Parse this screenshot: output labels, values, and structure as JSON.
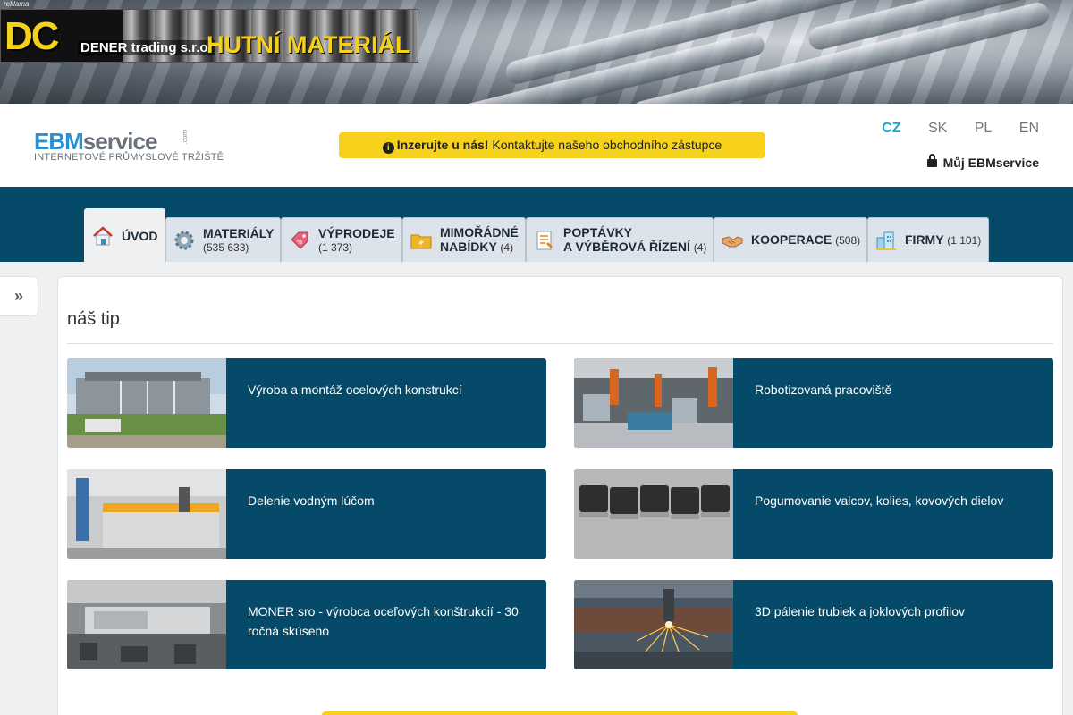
{
  "ad": {
    "label": "reklama",
    "logo": "DC",
    "company": "DENER trading s.r.o.",
    "headline": "HUTNÍ MATERIÁL"
  },
  "header": {
    "logo_ebm": "EBM",
    "logo_service": "service",
    "logo_com": ".com",
    "tagline": "INTERNETOVÉ PRŮMYSLOVÉ TRŽIŠTĚ",
    "notice_bold": "Inzerujte u nás!",
    "notice_text": " Kontaktujte našeho obchodního zástupce",
    "languages": [
      "CZ",
      "SK",
      "PL",
      "EN"
    ],
    "active_language": "CZ",
    "my_account": "Můj EBMservice"
  },
  "nav": {
    "tabs": [
      {
        "label": "ÚVOD",
        "count": "",
        "icon": "home-icon"
      },
      {
        "label": "MATERIÁLY",
        "count": "(535 633)",
        "icon": "gear-icon"
      },
      {
        "label": "VÝPRODEJE",
        "count": "(1 373)",
        "icon": "tag-icon"
      },
      {
        "label": "MIMOŘÁDNÉ",
        "label2": "NABÍDKY",
        "count": "(4)",
        "icon": "folder-icon"
      },
      {
        "label": "POPTÁVKY",
        "label2": "A VÝBĚROVÁ ŘÍZENÍ",
        "count": "(4)",
        "icon": "document-icon"
      },
      {
        "label": "KOOPERACE",
        "count": "(508)",
        "icon": "handshake-icon"
      },
      {
        "label": "FIRMY",
        "count": "(1 101)",
        "icon": "buildings-icon"
      }
    ]
  },
  "sidebar": {
    "toggle_icon": "»"
  },
  "main": {
    "section_title": "náš tip",
    "tips": [
      {
        "text": "Výroba a montáž ocelových konstrukcí"
      },
      {
        "text": "Robotizovaná pracoviště"
      },
      {
        "text": "Delenie vodným lúčom"
      },
      {
        "text": "Pogumovanie valcov, kolies, kovových dielov"
      },
      {
        "text": "MONER sro - výrobca oceľových konštrukcií - 30 ročná skúseno"
      },
      {
        "text": "3D pálenie trubiek a joklových profilov"
      }
    ]
  },
  "colors": {
    "brand_dark": "#054a68",
    "accent_yellow": "#f7d21c",
    "link_blue": "#1aa6d8"
  }
}
